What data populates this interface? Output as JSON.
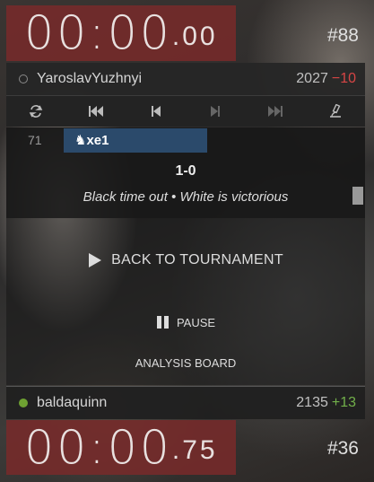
{
  "clock_top": {
    "main": "00:00",
    "sep": ".",
    "frac": "00"
  },
  "clock_bottom": {
    "main": "00:00",
    "sep": ".",
    "frac": "75"
  },
  "rank_top": "#88",
  "rank_bottom": "#36",
  "player_top": {
    "name": "YaroslavYuzhnyi",
    "rating": "2027",
    "delta": "−10",
    "status": "offline"
  },
  "player_bottom": {
    "name": "baldaquinn",
    "rating": "2135",
    "delta": "+13",
    "status": "online"
  },
  "controls": {
    "icons": [
      "flip-board-icon",
      "first-move-icon",
      "previous-move-icon",
      "next-move-icon",
      "last-move-icon",
      "analysis-icon"
    ]
  },
  "moves": {
    "number": "71",
    "current_move": "♞xe1"
  },
  "result": {
    "score": "1-0",
    "description": "Black time out • White is victorious"
  },
  "actions": {
    "back": "BACK TO TOURNAMENT",
    "pause": "PAUSE",
    "analysis": "ANALYSIS BOARD"
  },
  "colors": {
    "clock_bg": "#762a2a",
    "move_highlight": "#2b4a6b",
    "online": "#6ea132",
    "negative": "#d64545",
    "positive": "#72b04a"
  }
}
